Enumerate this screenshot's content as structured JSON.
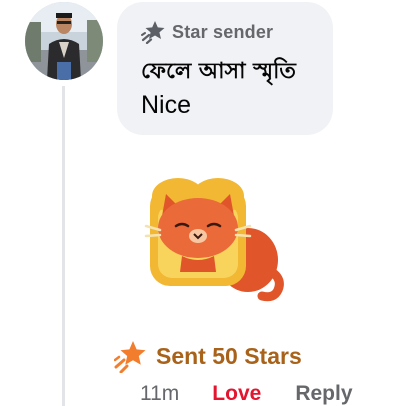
{
  "comment": {
    "badge_label": "Star sender",
    "author_name": "ফেলে আসা স্মৃতি",
    "message": "Nice",
    "stars_label": "Sent 50 Stars",
    "timestamp": "11m",
    "reaction_label": "Love",
    "reply_label": "Reply"
  },
  "colors": {
    "bubble": "#f0f2f5",
    "stars_accent": "#a8621a",
    "love": "#e4152f",
    "secondary_text": "#65676b"
  },
  "icons": {
    "badge": "star-sender-icon",
    "stars": "stars-icon"
  }
}
